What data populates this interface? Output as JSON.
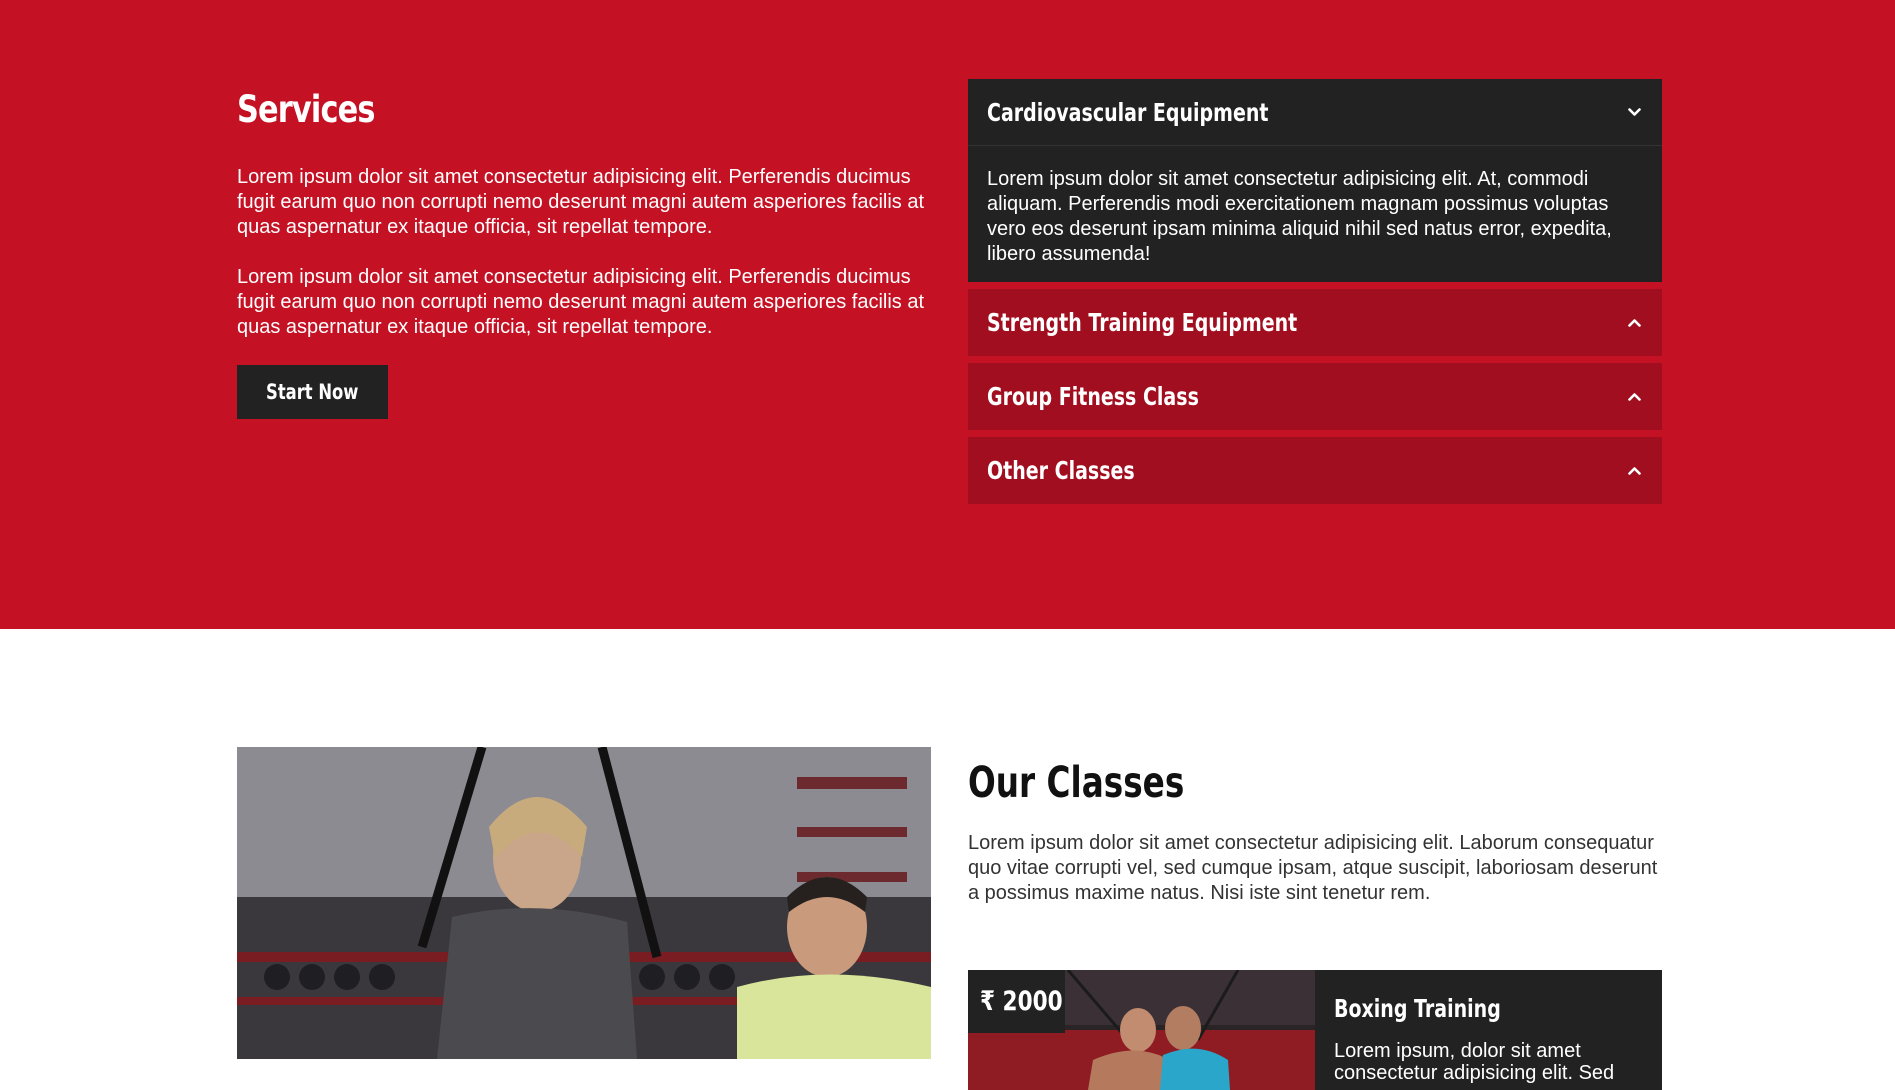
{
  "services": {
    "title": "Services",
    "paragraphs": [
      "Lorem ipsum dolor sit amet consectetur adipisicing elit. Perferendis ducimus fugit earum quo non corrupti nemo deserunt magni autem asperiores facilis at quas aspernatur ex itaque officia, sit repellat tempore.",
      "Lorem ipsum dolor sit amet consectetur adipisicing elit. Perferendis ducimus fugit earum quo non corrupti nemo deserunt magni autem asperiores facilis at quas aspernatur ex itaque officia, sit repellat tempore."
    ],
    "button_label": "Start Now",
    "accordion": [
      {
        "title": "Cardiovascular Equipment",
        "body": "Lorem ipsum dolor sit amet consectetur adipisicing elit. At, commodi aliquam. Perferendis modi exercitationem magnam possimus voluptas vero eos deserunt ipsam minima aliquid nihil sed natus error, expedita, libero assumenda!",
        "icon": "chevron-down-icon"
      },
      {
        "title": "Strength Training Equipment",
        "icon": "chevron-up-icon"
      },
      {
        "title": "Group Fitness Class",
        "icon": "chevron-up-icon"
      },
      {
        "title": "Other Classes",
        "icon": "chevron-up-icon"
      }
    ]
  },
  "classes": {
    "title": "Our Classes",
    "paragraph": "Lorem ipsum dolor sit amet consectetur adipisicing elit. Laborum consequatur quo vitae corrupti vel, sed cumque ipsam, atque suscipit, laboriosam deserunt a possimus maxime natus. Nisi iste sint tenetur rem.",
    "cards": [
      {
        "price": "₹ 2000",
        "title": "Boxing Training",
        "description": "Lorem ipsum, dolor sit amet consectetur adipisicing elit. Sed"
      }
    ]
  },
  "colors": {
    "brand_red": "#c41224",
    "dark_red": "#a10e1f",
    "dark": "#222222"
  }
}
